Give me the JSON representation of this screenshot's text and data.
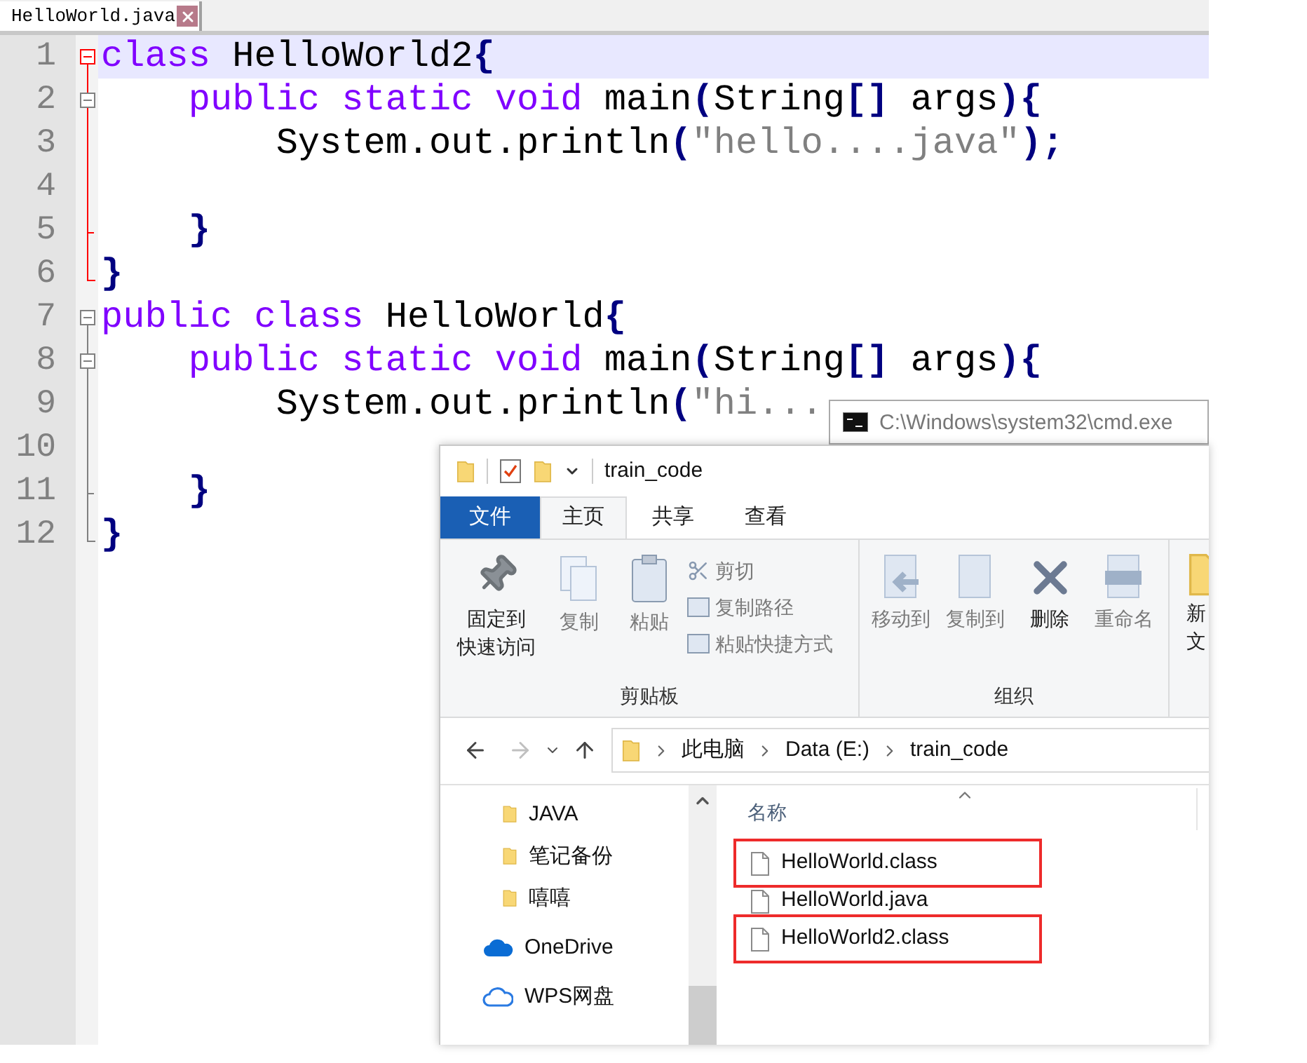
{
  "editor": {
    "tab": {
      "label": "HelloWorld.java"
    },
    "lines": [
      {
        "number": "1",
        "current": true,
        "kind": "open",
        "fold_active": true,
        "tokens": [
          {
            "kind": "keyword",
            "text": "class"
          },
          {
            "kind": "plain",
            "text": " HelloWorld2"
          },
          {
            "kind": "op",
            "text": "{"
          }
        ]
      },
      {
        "number": "2",
        "current": false,
        "kind": "open-nested",
        "fold_active": true,
        "tokens": [
          {
            "kind": "keyword",
            "text": "    public static void"
          },
          {
            "kind": "plain",
            "text": " main"
          },
          {
            "kind": "op",
            "text": "("
          },
          {
            "kind": "plain",
            "text": "String"
          },
          {
            "kind": "op",
            "text": "[]"
          },
          {
            "kind": "plain",
            "text": " args"
          },
          {
            "kind": "op",
            "text": "){"
          }
        ]
      },
      {
        "number": "3",
        "current": false,
        "kind": "mid",
        "fold_active": true,
        "tokens": [
          {
            "kind": "plain",
            "text": "        System.out.println"
          },
          {
            "kind": "op",
            "text": "("
          },
          {
            "kind": "string",
            "text": "\"hello....java\""
          },
          {
            "kind": "op",
            "text": ");"
          }
        ]
      },
      {
        "number": "4",
        "current": false,
        "kind": "mid",
        "fold_active": true
      },
      {
        "number": "5",
        "current": false,
        "kind": "inner-end",
        "fold_active": true,
        "tokens": [
          {
            "kind": "op",
            "text": "    }"
          }
        ]
      },
      {
        "number": "6",
        "current": false,
        "kind": "end",
        "fold_active": true,
        "tokens": [
          {
            "kind": "op",
            "text": "}"
          }
        ]
      },
      {
        "number": "7",
        "current": false,
        "kind": "open",
        "fold_active": false,
        "tokens": [
          {
            "kind": "keyword",
            "text": "public class"
          },
          {
            "kind": "plain",
            "text": " HelloWorld"
          },
          {
            "kind": "op",
            "text": "{"
          }
        ]
      },
      {
        "number": "8",
        "current": false,
        "kind": "open-nested",
        "fold_active": false,
        "tokens": [
          {
            "kind": "keyword",
            "text": "    public static void"
          },
          {
            "kind": "plain",
            "text": " main"
          },
          {
            "kind": "op",
            "text": "("
          },
          {
            "kind": "plain",
            "text": "String"
          },
          {
            "kind": "op",
            "text": "[]"
          },
          {
            "kind": "plain",
            "text": " args"
          },
          {
            "kind": "op",
            "text": "){"
          }
        ]
      },
      {
        "number": "9",
        "current": false,
        "kind": "mid",
        "fold_active": false,
        "tokens": [
          {
            "kind": "plain",
            "text": "        System.out.println"
          },
          {
            "kind": "op",
            "text": "("
          },
          {
            "kind": "string",
            "text": "\"hi..."
          }
        ]
      },
      {
        "number": "10",
        "current": false,
        "kind": "mid",
        "fold_active": false
      },
      {
        "number": "11",
        "current": false,
        "kind": "inner-end",
        "fold_active": false,
        "tokens": [
          {
            "kind": "op",
            "text": "    }"
          }
        ]
      },
      {
        "number": "12",
        "current": false,
        "kind": "end",
        "fold_active": false,
        "tokens": [
          {
            "kind": "op",
            "text": "}"
          }
        ]
      }
    ]
  },
  "cmd_window": {
    "title": "C:\\Windows\\system32\\cmd.exe"
  },
  "explorer": {
    "title": "train_code",
    "ribbon_tabs": [
      {
        "label": "文件",
        "kind": "file",
        "selected": false
      },
      {
        "label": "主页",
        "kind": "tab",
        "selected": true
      },
      {
        "label": "共享",
        "kind": "tab",
        "selected": false
      },
      {
        "label": "查看",
        "kind": "tab",
        "selected": false
      }
    ],
    "clipboard_group": {
      "label": "剪贴板",
      "pin": {
        "lines": [
          "固定到",
          "快速访问"
        ],
        "disabled": false
      },
      "copy": {
        "lines": [
          "复制"
        ],
        "disabled": true
      },
      "paste": {
        "lines": [
          "粘贴"
        ],
        "disabled": true
      },
      "small": [
        {
          "label": "剪切",
          "disabled": true
        },
        {
          "label": "复制路径",
          "disabled": true
        },
        {
          "label": "粘贴快捷方式",
          "disabled": true
        }
      ]
    },
    "organize_group": {
      "label": "组织",
      "move_to": {
        "label": "移动到",
        "disabled": true
      },
      "copy_to": {
        "label": "复制到",
        "disabled": true
      },
      "delete": {
        "label": "删除",
        "disabled": false
      },
      "rename": {
        "label": "重命名",
        "disabled": true
      }
    },
    "new_group": {
      "lines": [
        "新",
        "文"
      ]
    },
    "breadcrumbs": [
      "此电脑",
      "Data (E:)",
      "train_code"
    ],
    "nav_items": [
      {
        "label": "JAVA",
        "kind": "folder"
      },
      {
        "label": "笔记备份",
        "kind": "folder"
      },
      {
        "label": "嘻嘻",
        "kind": "folder"
      },
      {
        "label": "OneDrive",
        "kind": "onedrive"
      },
      {
        "label": "WPS网盘",
        "kind": "wps"
      }
    ],
    "column_header": "名称",
    "files": [
      {
        "name": "HelloWorld.class",
        "highlighted": true
      },
      {
        "name": "HelloWorld.java",
        "highlighted": false
      },
      {
        "name": "HelloWorld2.class",
        "highlighted": true
      }
    ]
  }
}
